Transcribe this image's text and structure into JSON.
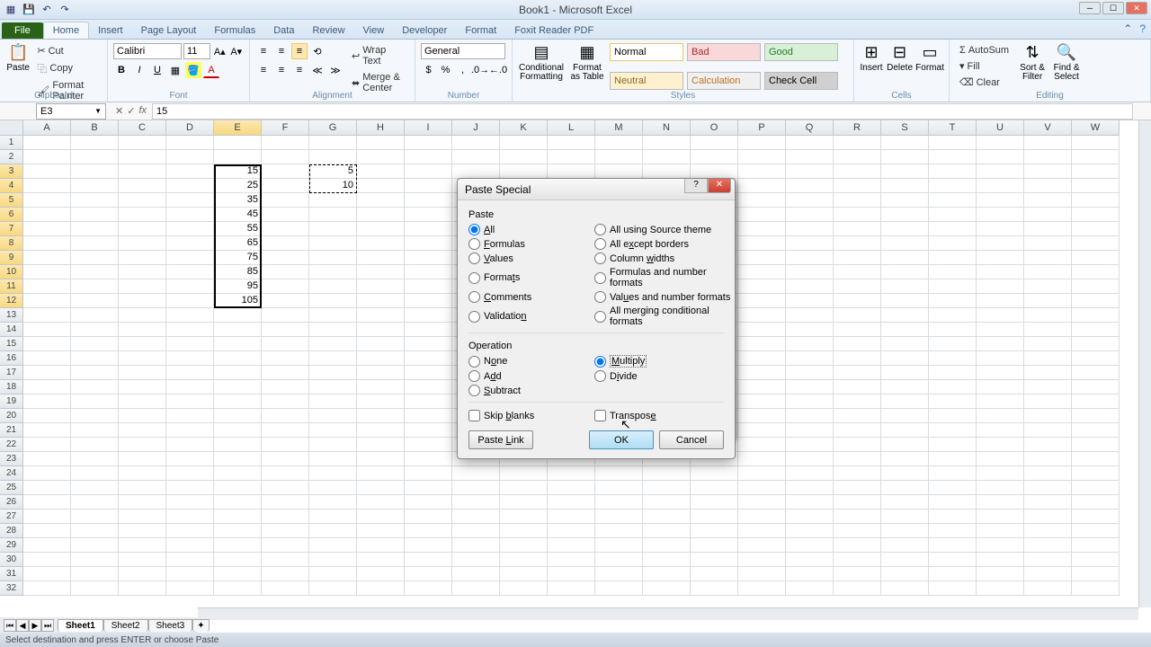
{
  "app": {
    "title": "Book1 - Microsoft Excel"
  },
  "tabs": {
    "file": "File",
    "home": "Home",
    "insert": "Insert",
    "page_layout": "Page Layout",
    "formulas": "Formulas",
    "data": "Data",
    "review": "Review",
    "view": "View",
    "developer": "Developer",
    "format": "Format",
    "foxit": "Foxit Reader PDF"
  },
  "ribbon": {
    "clipboard": {
      "paste": "Paste",
      "cut": "Cut",
      "copy": "Copy",
      "format_painter": "Format Painter",
      "label": "Clipboard"
    },
    "font": {
      "name": "Calibri",
      "size": "11",
      "label": "Font"
    },
    "alignment": {
      "wrap": "Wrap Text",
      "merge": "Merge & Center",
      "label": "Alignment"
    },
    "number": {
      "format": "General",
      "label": "Number"
    },
    "styles": {
      "cond": "Conditional Formatting",
      "table": "Format as Table",
      "normal": "Normal",
      "bad": "Bad",
      "good": "Good",
      "neutral": "Neutral",
      "calc": "Calculation",
      "check": "Check Cell",
      "label": "Styles"
    },
    "cells": {
      "insert": "Insert",
      "delete": "Delete",
      "format": "Format",
      "label": "Cells"
    },
    "editing": {
      "autosum": "AutoSum",
      "fill": "Fill",
      "clear": "Clear",
      "sort": "Sort & Filter",
      "find": "Find & Select",
      "label": "Editing"
    }
  },
  "namebox": "E3",
  "formula": "15",
  "columns": [
    "A",
    "B",
    "C",
    "D",
    "E",
    "F",
    "G",
    "H",
    "I",
    "J",
    "K",
    "L",
    "M",
    "N",
    "O",
    "P",
    "Q",
    "R",
    "S",
    "T",
    "U",
    "V",
    "W"
  ],
  "rows_count": 32,
  "data_e": [
    "15",
    "25",
    "35",
    "45",
    "55",
    "65",
    "75",
    "85",
    "95",
    "105"
  ],
  "data_g": [
    "5",
    "10"
  ],
  "sheets": {
    "s1": "Sheet1",
    "s2": "Sheet2",
    "s3": "Sheet3"
  },
  "status": "Select destination and press ENTER or choose Paste",
  "dialog": {
    "title": "Paste Special",
    "paste_label": "Paste",
    "paste_opts": {
      "all": "All",
      "formulas": "Formulas",
      "values": "Values",
      "formats": "Formats",
      "comments": "Comments",
      "validation": "Validation",
      "all_source": "All using Source theme",
      "all_except": "All except borders",
      "col_widths": "Column widths",
      "form_num": "Formulas and number formats",
      "val_num": "Values and number formats",
      "all_merge": "All merging conditional formats"
    },
    "op_label": "Operation",
    "op_opts": {
      "none": "None",
      "add": "Add",
      "subtract": "Subtract",
      "multiply": "Multiply",
      "divide": "Divide"
    },
    "skip": "Skip blanks",
    "transpose": "Transpose",
    "paste_link": "Paste Link",
    "ok": "OK",
    "cancel": "Cancel"
  }
}
